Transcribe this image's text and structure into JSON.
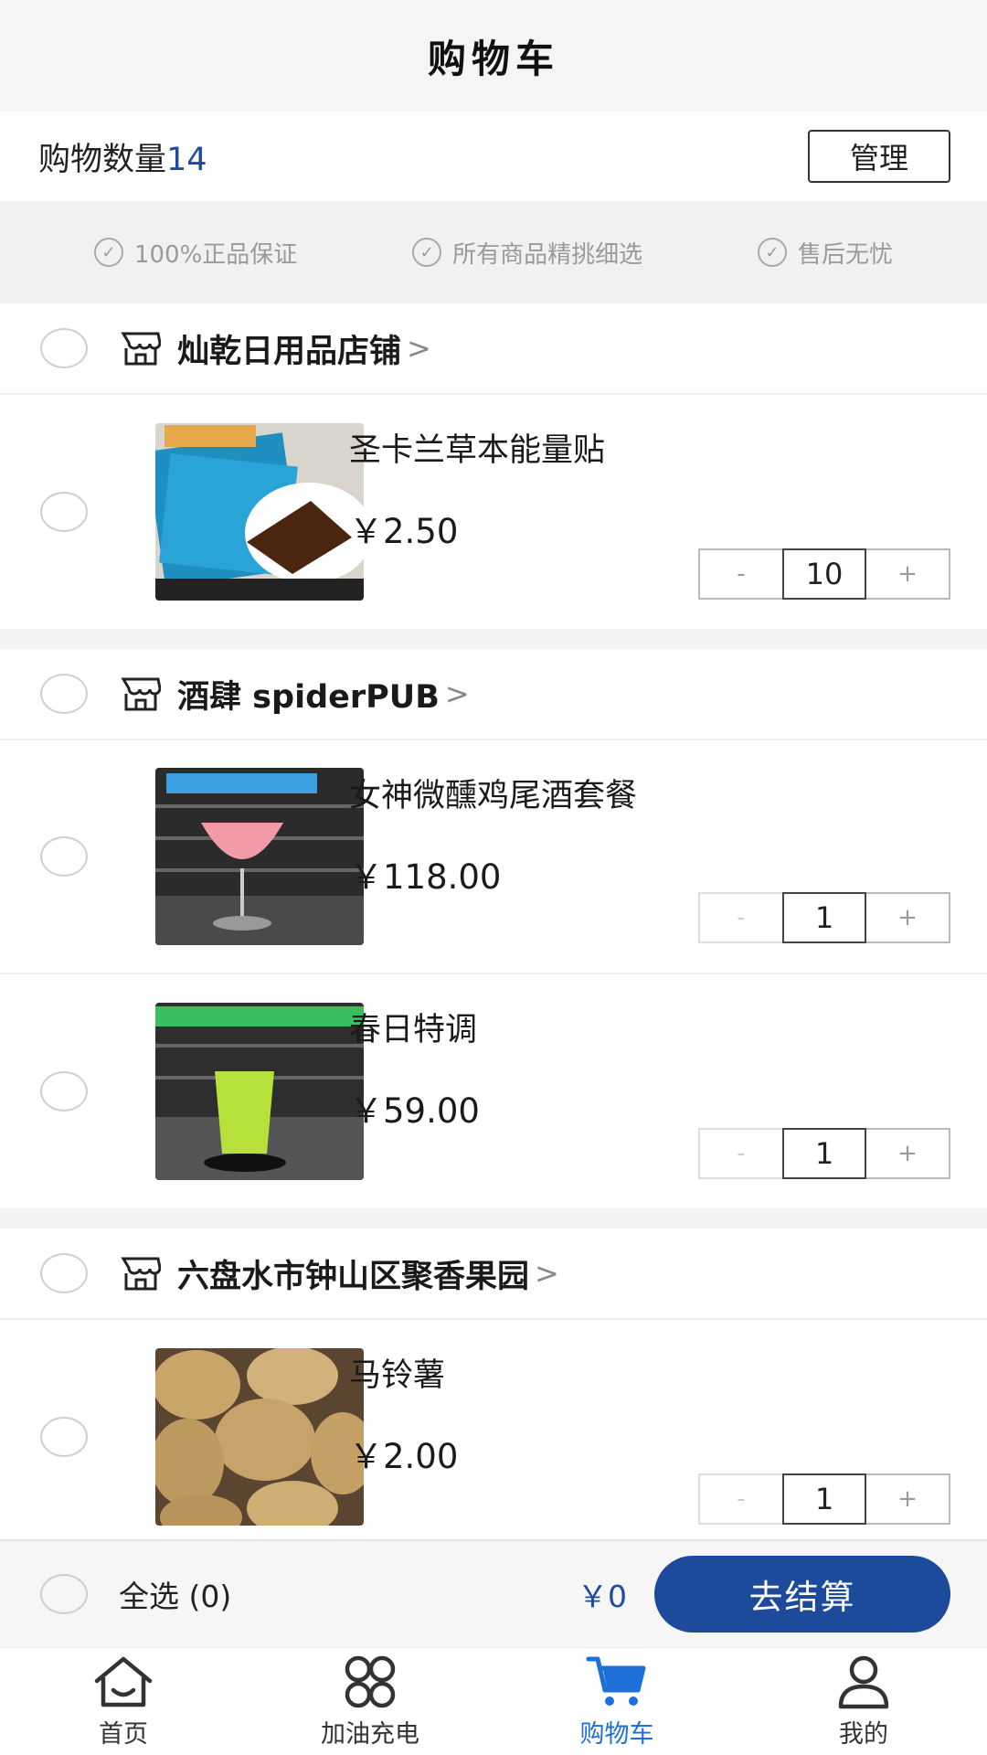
{
  "header": {
    "title": "购物车"
  },
  "countbar": {
    "label": "购物数量",
    "count": "14",
    "manage_label": "管理"
  },
  "guarantees": [
    {
      "icon": "check-circle-icon",
      "text": "100%正品保证"
    },
    {
      "icon": "check-circle-icon",
      "text": "所有商品精挑细选"
    },
    {
      "icon": "check-circle-icon",
      "text": "售后无忧"
    }
  ],
  "shops": [
    {
      "name": "灿乾日用品店铺",
      "arrow": ">",
      "items": [
        {
          "name": "圣卡兰草本能量贴",
          "price": "￥2.50",
          "quantity": "10",
          "minus": "-",
          "plus": "+",
          "minus_disabled": false
        }
      ]
    },
    {
      "name": "酒肆 spiderPUB",
      "arrow": ">",
      "items": [
        {
          "name": "女神微醺鸡尾酒套餐",
          "price": "￥118.00",
          "quantity": "1",
          "minus": "-",
          "plus": "+",
          "minus_disabled": true
        },
        {
          "name": "春日特调",
          "price": "￥59.00",
          "quantity": "1",
          "minus": "-",
          "plus": "+",
          "minus_disabled": true
        }
      ]
    },
    {
      "name": "六盘水市钟山区聚香果园",
      "arrow": ">",
      "items": [
        {
          "name": "马铃薯",
          "price": "￥2.00",
          "quantity": "1",
          "minus": "-",
          "plus": "+",
          "minus_disabled": true
        }
      ]
    }
  ],
  "checkout": {
    "select_all_label": "全选 (0)",
    "total": "￥0",
    "button_label": "去结算"
  },
  "tabbar": [
    {
      "label": "首页",
      "icon": "home-icon",
      "active": false
    },
    {
      "label": "加油充电",
      "icon": "apps-icon",
      "active": false
    },
    {
      "label": "购物车",
      "icon": "cart-icon",
      "active": true
    },
    {
      "label": "我的",
      "icon": "user-icon",
      "active": false
    }
  ],
  "colors": {
    "accent": "#1e4a9c",
    "count": "#1e4aa0",
    "tab_active": "#1e6fd8"
  }
}
